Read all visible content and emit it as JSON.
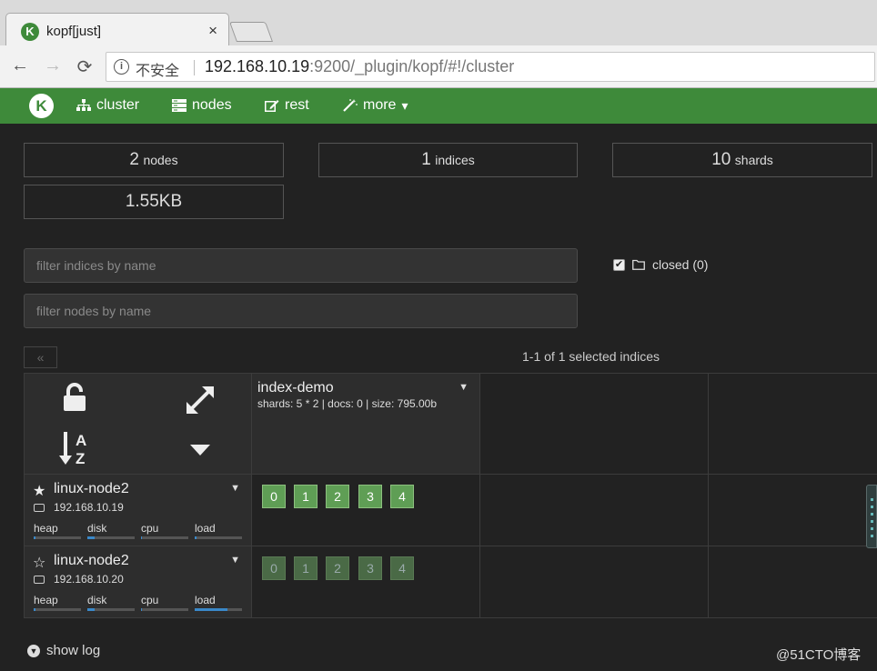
{
  "browser": {
    "tab_title": "kopf[just]",
    "tab_close": "×",
    "favicon_letter": "K",
    "security_label": "不安全",
    "url_host": "192.168.10.19",
    "url_rest": ":9200/_plugin/kopf/#!/cluster",
    "back": "←",
    "forward": "→",
    "reload": "⟳"
  },
  "navbar": {
    "brand_letter": "K",
    "items": [
      {
        "label": "cluster",
        "icon": "sitemap-icon"
      },
      {
        "label": "nodes",
        "icon": "server-icon"
      },
      {
        "label": "rest",
        "icon": "edit-icon"
      },
      {
        "label": "more",
        "icon": "magic-wand-icon"
      }
    ],
    "more_caret": "▾"
  },
  "stats": {
    "nodes": {
      "num": "2",
      "unit": "nodes"
    },
    "indices": {
      "num": "1",
      "unit": "indices"
    },
    "shards": {
      "num": "10",
      "unit": "shards"
    },
    "size": "1.55KB"
  },
  "filters": {
    "indices_placeholder": "filter indices by name",
    "nodes_placeholder": "filter nodes by name",
    "closed_label": "closed (0)",
    "closed_checked": "✔"
  },
  "pager": {
    "prev": "«",
    "label": "1-1 of 1 selected indices"
  },
  "index": {
    "name": "index-demo",
    "stats": "shards: 5 * 2 | docs: 0 | size: 795.00b",
    "caret": "▼"
  },
  "nodes": [
    {
      "star": "★",
      "name": "linux-node2",
      "ip": "192.168.10.19",
      "caret": "▼",
      "metrics": [
        {
          "label": "heap",
          "value": 0.04
        },
        {
          "label": "disk",
          "value": 0.15
        },
        {
          "label": "cpu",
          "value": 0.02
        },
        {
          "label": "load",
          "value": 0.04
        }
      ],
      "shards": [
        "0",
        "1",
        "2",
        "3",
        "4"
      ]
    },
    {
      "star": "☆",
      "name": "linux-node2",
      "ip": "192.168.10.20",
      "caret": "▼",
      "metrics": [
        {
          "label": "heap",
          "value": 0.04
        },
        {
          "label": "disk",
          "value": 0.15
        },
        {
          "label": "cpu",
          "value": 0.02
        },
        {
          "label": "load",
          "value": 0.7
        }
      ],
      "shards": [
        "0",
        "1",
        "2",
        "3",
        "4"
      ]
    }
  ],
  "footer": {
    "show_log": "show log",
    "show_log_icon": "▼",
    "watermark": "@51CTO博客"
  },
  "colors": {
    "brand": "#3e8a3a",
    "background": "#222222",
    "primary_shard": "#5f9e55",
    "replica_shard": "#4a6a46",
    "metric_fill": "#3a88c8"
  }
}
